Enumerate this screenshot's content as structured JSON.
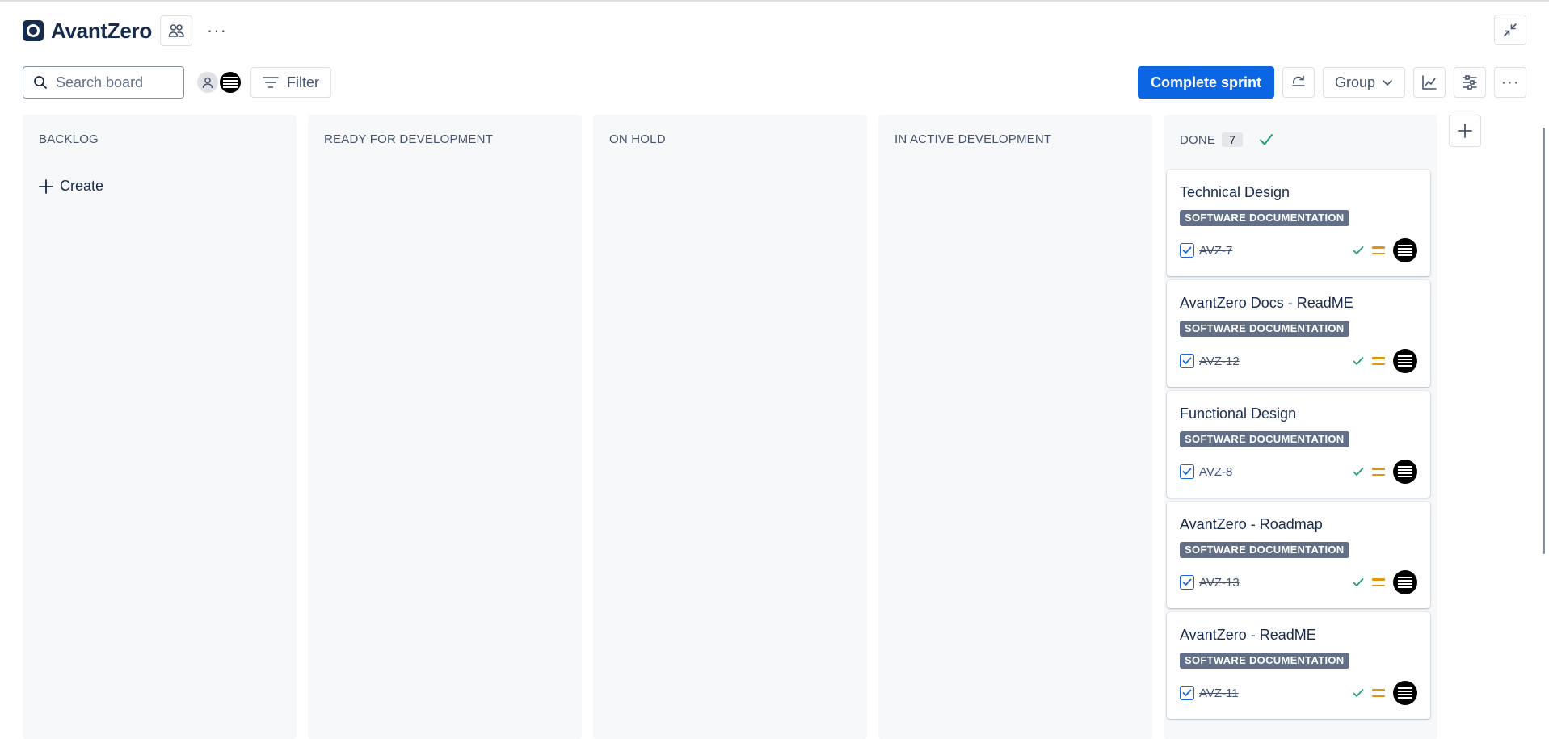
{
  "project": {
    "title": "AvantZero"
  },
  "toolbar": {
    "search_placeholder": "Search board",
    "filter_label": "Filter",
    "complete_sprint_label": "Complete sprint",
    "group_label": "Group"
  },
  "columns": [
    {
      "title": "BACKLOG",
      "create_label": "Create"
    },
    {
      "title": "READY FOR DEVELOPMENT"
    },
    {
      "title": "ON HOLD"
    },
    {
      "title": "IN ACTIVE DEVELOPMENT"
    },
    {
      "title": "DONE",
      "count": "7"
    }
  ],
  "cards": [
    {
      "title": "Technical Design",
      "tag": "SOFTWARE DOCUMENTATION",
      "key": "AVZ-7"
    },
    {
      "title": "AvantZero Docs - ReadME",
      "tag": "SOFTWARE DOCUMENTATION",
      "key": "AVZ-12"
    },
    {
      "title": "Functional Design",
      "tag": "SOFTWARE DOCUMENTATION",
      "key": "AVZ-8"
    },
    {
      "title": "AvantZero - Roadmap",
      "tag": "SOFTWARE DOCUMENTATION",
      "key": "AVZ-13"
    },
    {
      "title": "AvantZero - ReadME",
      "tag": "SOFTWARE DOCUMENTATION",
      "key": "AVZ-11"
    }
  ],
  "colors": {
    "primary": "#0c66e4",
    "done_check": "#22a06b",
    "priority_medium": "#e2940e",
    "tag_bg": "#626f86"
  },
  "icons": [
    "project-logo-icon",
    "team-icon",
    "more-icon",
    "collapse-icon",
    "search-icon",
    "filter-icon",
    "automation-icon",
    "chevron-down-icon",
    "insights-icon",
    "view-settings-icon",
    "plus-icon",
    "check-icon",
    "task-checkbox-icon",
    "priority-medium-icon"
  ]
}
